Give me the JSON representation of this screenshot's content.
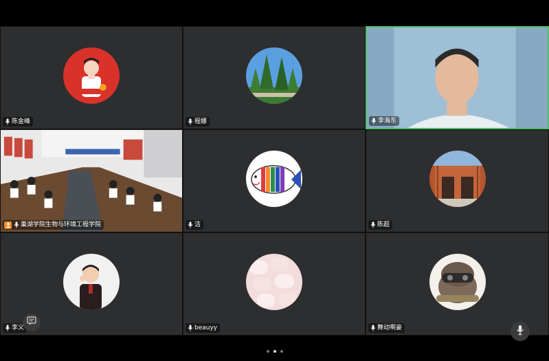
{
  "participants": [
    {
      "name": "陈金峰",
      "avatar": "person-avatar"
    },
    {
      "name": "程娜",
      "avatar": "trees-avatar"
    },
    {
      "name": "李海东",
      "avatar": "camera-video",
      "speaking": true
    },
    {
      "name": "巢湖学院生物与环境工程学院",
      "avatar": "classroom-video",
      "host": true
    },
    {
      "name": "洁",
      "avatar": "fish-drawing-avatar"
    },
    {
      "name": "陈超",
      "avatar": "building-avatar"
    },
    {
      "name": "李义",
      "avatar": "child-avatar"
    },
    {
      "name": "beauyy",
      "avatar": "marshmallow-avatar"
    },
    {
      "name": "舞动啊豪",
      "avatar": "cartoon-avatar"
    }
  ],
  "colors": {
    "tile_bg": "#2d2e30",
    "speaking_border": "#4fbf6b",
    "host_badge": "#f08a24"
  },
  "pager": {
    "pages": 3,
    "current": 2
  }
}
